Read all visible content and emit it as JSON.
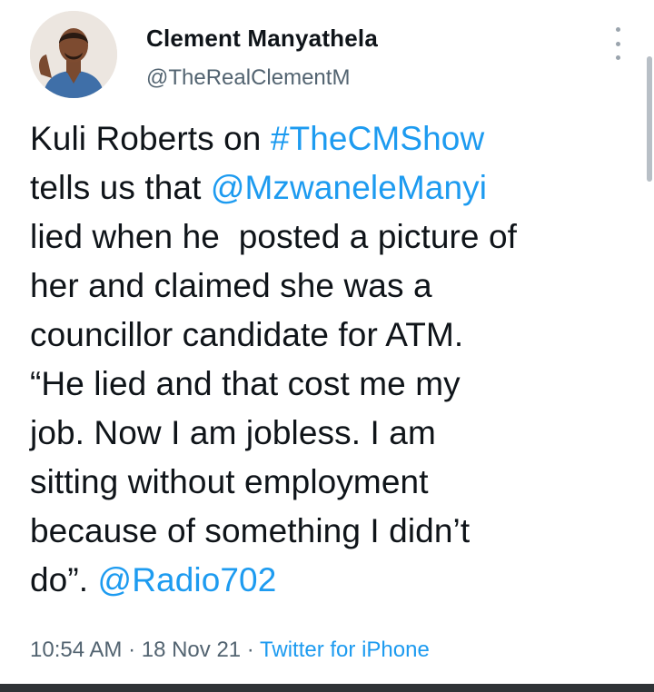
{
  "author": {
    "name": "Clement Manyathela",
    "handle": "@TheRealClementM"
  },
  "tweet": {
    "lines": [
      [
        {
          "t": "Kuli Roberts on "
        },
        {
          "t": "#TheCMShow",
          "link": true
        }
      ],
      [
        {
          "t": "tells us that "
        },
        {
          "t": "@MzwaneleManyi",
          "link": true
        }
      ],
      [
        {
          "t": "lied when he  posted a picture of"
        }
      ],
      [
        {
          "t": "her and claimed she was a"
        }
      ],
      [
        {
          "t": "councillor candidate for ATM."
        }
      ],
      [
        {
          "t": "“He lied and that cost me my"
        }
      ],
      [
        {
          "t": "job. Now I am jobless. I am"
        }
      ],
      [
        {
          "t": "sitting without employment"
        }
      ],
      [
        {
          "t": "because of something I didn’t"
        }
      ],
      [
        {
          "t": "do”. "
        },
        {
          "t": "@Radio702",
          "link": true
        }
      ]
    ]
  },
  "meta": {
    "time": "10:54 AM",
    "sep1": " · ",
    "date": "18 Nov 21",
    "sep2": " · ",
    "source": "Twitter for iPhone"
  },
  "colors": {
    "link": "#1d9bf0",
    "text": "#0f1419",
    "secondary": "#536471"
  },
  "icons": {
    "more": "more-options-icon"
  }
}
